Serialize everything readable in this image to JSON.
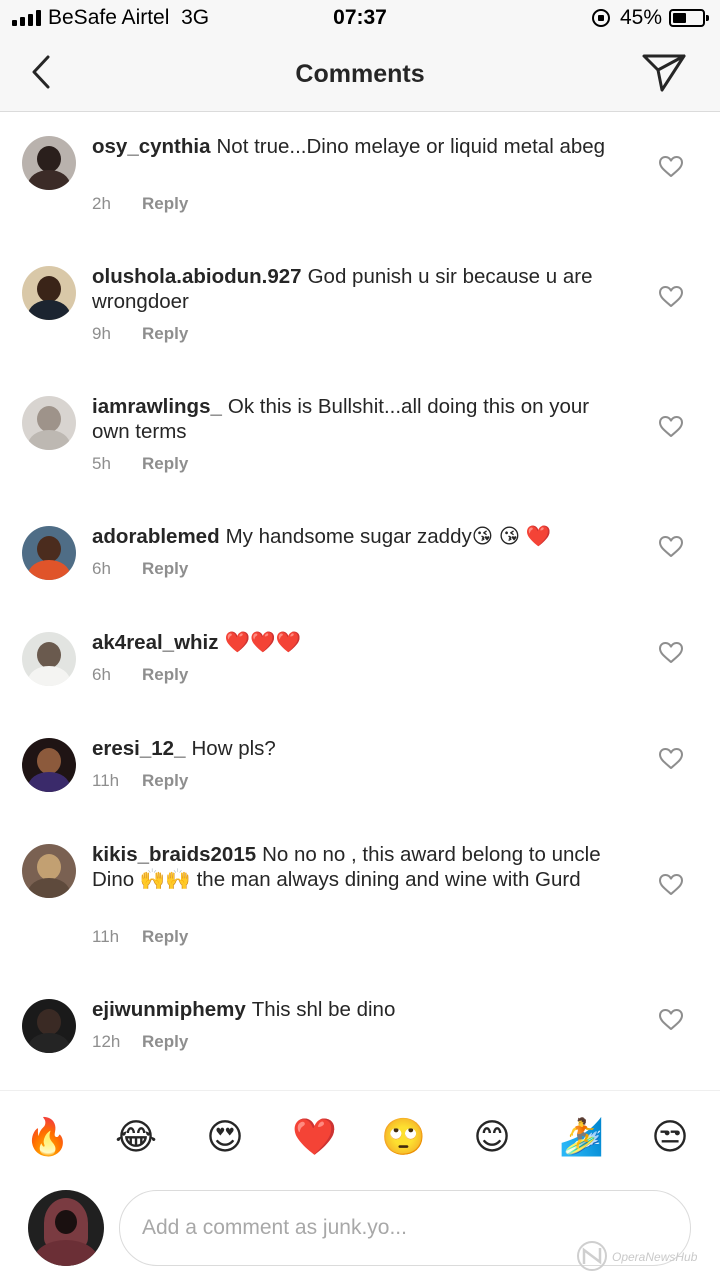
{
  "status_bar": {
    "carrier": "BeSafe Airtel",
    "network": "3G",
    "time": "07:37",
    "battery_percent": "45%",
    "battery_level": 0.45,
    "signal_bars": 4
  },
  "header": {
    "title": "Comments",
    "back_icon": "chevron-left-icon",
    "send_icon": "paper-plane-icon"
  },
  "comments": [
    {
      "username": "osy_cynthia",
      "text": "Not true...Dino melaye or liquid metal abeg",
      "time": "2h",
      "reply_label": "Reply"
    },
    {
      "username": "olushola.abiodun.927",
      "text": "God punish u sir because u are wrongdoer",
      "time": "9h",
      "reply_label": "Reply"
    },
    {
      "username": "iamrawlings_",
      "text": "Ok this is Bullshit...all doing this on your own terms",
      "time": "5h",
      "reply_label": "Reply"
    },
    {
      "username": "adorablemed",
      "text": "My handsome sugar zaddy😘 😘 ❤️",
      "time": "6h",
      "reply_label": "Reply"
    },
    {
      "username": "ak4real_whiz",
      "text": "❤️❤️❤️",
      "time": "6h",
      "reply_label": "Reply"
    },
    {
      "username": "eresi_12_",
      "text": "How pls?",
      "time": "11h",
      "reply_label": "Reply"
    },
    {
      "username": "kikis_braids2015",
      "text": "No no no , this award belong to uncle Dino 🙌🙌 the man always  dining and wine with Gurd",
      "time": "11h",
      "reply_label": "Reply"
    },
    {
      "username": "ejiwunmiphemy",
      "text": "This shl be dino",
      "time": "12h",
      "reply_label": "Reply"
    }
  ],
  "emoji_bar": [
    "🔥",
    "😂",
    "😍",
    "❤️",
    "🙄",
    "😊",
    "🏄",
    "😒"
  ],
  "composer": {
    "placeholder": "Add a comment as junk.yo..."
  },
  "watermark": {
    "text": "OperaNewsHub"
  },
  "colors": {
    "text": "#262626",
    "secondary_text": "#8e8e8e",
    "bar_background": "#f7f7f7",
    "divider": "#dbdbdb"
  }
}
